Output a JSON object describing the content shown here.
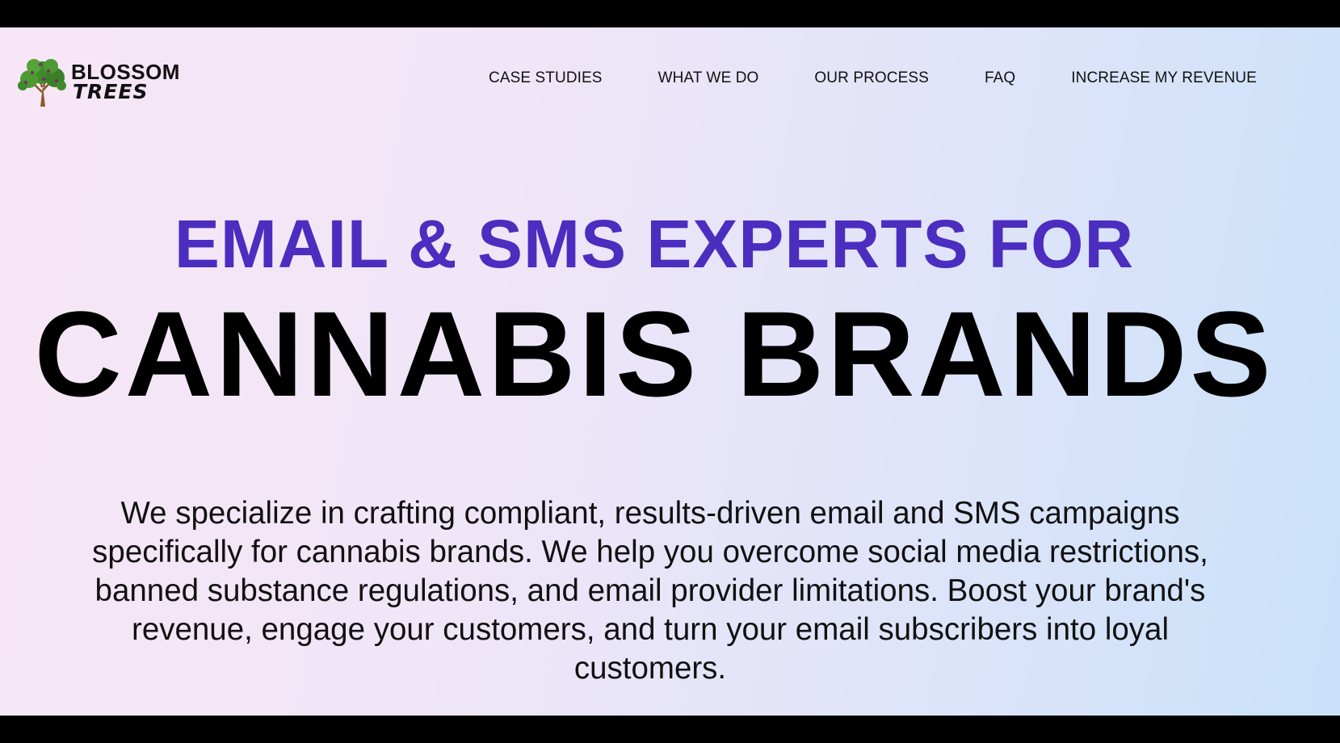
{
  "brand": {
    "name_top": "BLOSSOM",
    "name_bottom": "TREES",
    "logo_icon": "tree-icon",
    "colors": {
      "leaf": "#3f8a2a",
      "trunk": "#8a5a2b",
      "flower": "#7a2a6a"
    }
  },
  "nav": {
    "items": [
      {
        "label": "CASE STUDIES"
      },
      {
        "label": "WHAT WE DO"
      },
      {
        "label": "OUR PROCESS"
      },
      {
        "label": "FAQ"
      },
      {
        "label": "INCREASE MY REVENUE"
      }
    ]
  },
  "hero": {
    "headline_top": "EMAIL & SMS EXPERTS FOR",
    "headline_main": "CANNABIS BRANDS",
    "description": "We specialize in crafting compliant, results-driven email and SMS campaigns specifically for cannabis brands. We help you overcome social media restrictions, banned substance regulations, and email provider limitations. Boost your brand's revenue, engage your customers, and turn your email subscribers into loyal customers."
  },
  "colors": {
    "accent": "#4b2dbf",
    "text": "#000000"
  }
}
